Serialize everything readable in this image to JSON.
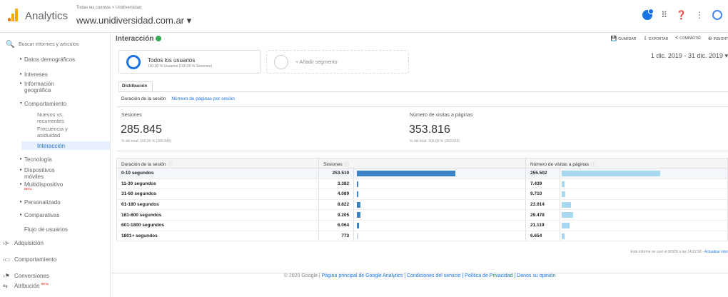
{
  "header": {
    "brand": "Analytics",
    "breadcrumb": "Todas las cuentas > Unidiversidad",
    "property": "www.unidiversidad.com.ar ▾",
    "colors": {
      "logo_orange": "#f9ab00",
      "logo_dark": "#e37400",
      "accent": "#1a73e8"
    }
  },
  "sidebar": {
    "search_placeholder": "Buscar informes y artículos",
    "items": [
      {
        "label": "Datos demográficos"
      },
      {
        "label": "Intereses"
      },
      {
        "label": "Información geográfica"
      },
      {
        "label": "Comportamiento"
      }
    ],
    "sub_items": [
      {
        "label": "Nuevos vs. recurrentes"
      },
      {
        "label": "Frecuencia y asiduidad"
      },
      {
        "label": "Interacción"
      }
    ],
    "more_items": [
      {
        "label": "Tecnología"
      },
      {
        "label": "Dispositivos móviles"
      },
      {
        "label": "Multidispositivo",
        "badge": "BETA"
      },
      {
        "label": "Personalizado"
      },
      {
        "label": "Comparativas"
      },
      {
        "label": "Flujo de usuarios"
      }
    ],
    "main_sections": [
      {
        "label": "Adquisición",
        "icon": "acquisition-icon"
      },
      {
        "label": "Comportamiento",
        "icon": "behavior-icon"
      },
      {
        "label": "Conversiones",
        "icon": "flag-icon"
      },
      {
        "label": "Atribución",
        "icon": "attribution-icon",
        "badge": "BETA"
      }
    ]
  },
  "main": {
    "title": "Interacción",
    "actions": [
      {
        "label": "GUARDAR",
        "icon": "save-icon"
      },
      {
        "label": "EXPORTAR",
        "icon": "export-icon"
      },
      {
        "label": "COMPARTIR",
        "icon": "share-icon"
      },
      {
        "label": "INSIGHT",
        "icon": "insights-icon"
      }
    ],
    "segment": {
      "title": "Todos los usuarios",
      "sub": "100,00 % Usuarios (100,00 % Sesiones)"
    },
    "add_segment": "+ Añadir segmento",
    "date_range": "1 dic. 2019 - 31 dic. 2019 ▾",
    "tab": "Distribución",
    "subtab_active": "Duración de la sesión",
    "subtab_link": "Número de páginas por sesión",
    "metrics": [
      {
        "label": "Sesiones",
        "value": "285.845",
        "pct": "% del total: 100,00 % (285.845)"
      },
      {
        "label": "Número de visitas a páginas",
        "value": "353.816",
        "pct": "% del total: 100,00 % (353.816)"
      }
    ],
    "table": {
      "headers": [
        "Duración de la sesión",
        "Sesiones",
        "Número de visitas a páginas"
      ],
      "rows": [
        {
          "label": "0-10 segundos",
          "sessions": "253.510",
          "pageviews": "255.502",
          "sessions_n": 253510,
          "pageviews_n": 255502
        },
        {
          "label": "11-30 segundos",
          "sessions": "3.382",
          "pageviews": "7.439",
          "sessions_n": 3382,
          "pageviews_n": 7439
        },
        {
          "label": "31-60 segundos",
          "sessions": "4.089",
          "pageviews": "9.710",
          "sessions_n": 4089,
          "pageviews_n": 9710
        },
        {
          "label": "61-180 segundos",
          "sessions": "8.822",
          "pageviews": "23.914",
          "sessions_n": 8822,
          "pageviews_n": 23914
        },
        {
          "label": "181-600 segundos",
          "sessions": "9.205",
          "pageviews": "29.478",
          "sessions_n": 9205,
          "pageviews_n": 29478
        },
        {
          "label": "601-1800 segundos",
          "sessions": "6.064",
          "pageviews": "21.119",
          "sessions_n": 6064,
          "pageviews_n": 21119
        },
        {
          "label": "1801+ segundos",
          "sessions": "773",
          "pageviews": "6.654",
          "sessions_n": 773,
          "pageviews_n": 6654
        }
      ],
      "bar_colors": {
        "sessions": "#3b82c4",
        "pageviews": "#a8d8f0"
      }
    },
    "report_note": "Este informe se creó el 9/3/20 a las 14:22:58 - ",
    "report_link": "Actualizar infor"
  },
  "footer": {
    "copyright": "© 2020 Google | ",
    "links": "Página principal de Google Analytics | Condiciones del servicio | Política de Privacidad | Denos su opinión"
  }
}
